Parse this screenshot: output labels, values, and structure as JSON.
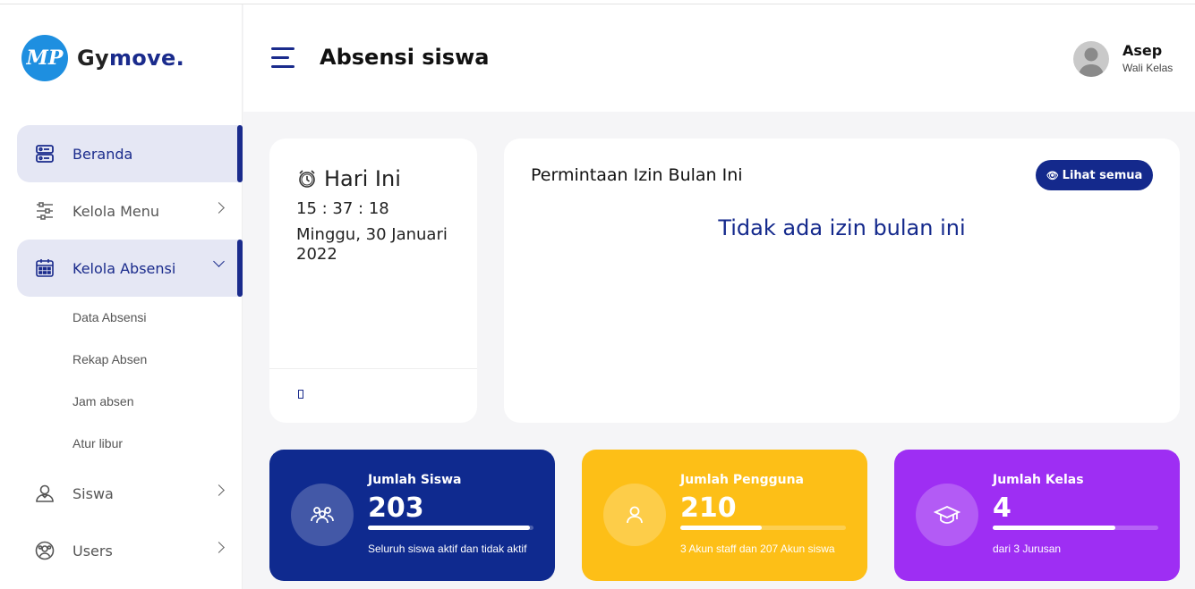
{
  "app": {
    "logo_mark": "MP",
    "logo_name_prefix": "Gy",
    "logo_name_suffix": "move."
  },
  "sidebar": {
    "items": [
      {
        "label": "Beranda",
        "icon": "dashboard-icon",
        "active": true
      },
      {
        "label": "Kelola Menu",
        "icon": "sliders-icon",
        "active": false
      },
      {
        "label": "Kelola Absensi",
        "icon": "calendar-icon",
        "active": true,
        "expanded": true
      },
      {
        "label": "Siswa",
        "icon": "student-icon",
        "active": false
      },
      {
        "label": "Users",
        "icon": "users-icon",
        "active": false
      }
    ],
    "subitems": [
      "Data Absensi",
      "Rekap Absen",
      "Jam absen",
      "Atur libur"
    ]
  },
  "header": {
    "title": "Absensi siswa",
    "user": {
      "name": "Asep",
      "role": "Wali Kelas"
    }
  },
  "today": {
    "title": "Hari Ini",
    "time": "15 : 37 : 18",
    "date": "Minggu, 30 Januari 2022",
    "footer_glyph": "▯"
  },
  "requests": {
    "title": "Permintaan Izin Bulan Ini",
    "button": "Lihat semua",
    "empty_message": "Tidak ada izin bulan ini"
  },
  "stats": [
    {
      "label": "Jumlah Siswa",
      "value": "203",
      "note": "Seluruh siswa aktif dan tidak aktif",
      "progress": 0.98,
      "color": "#0f2a8f",
      "icon": "group-icon"
    },
    {
      "label": "Jumlah Pengguna",
      "value": "210",
      "note": "3 Akun staff dan 207 Akun siswa",
      "progress": 0.49,
      "color": "#fdbf17",
      "icon": "user-icon"
    },
    {
      "label": "Jumlah Kelas",
      "value": "4",
      "note": "dari 3 Jurusan",
      "progress": 0.74,
      "color": "#9e2ef3",
      "icon": "graduation-cap-icon"
    }
  ],
  "colors": {
    "primary": "#14298c",
    "active_bg": "#e5e7f4",
    "logo": "#1e8fe0"
  }
}
